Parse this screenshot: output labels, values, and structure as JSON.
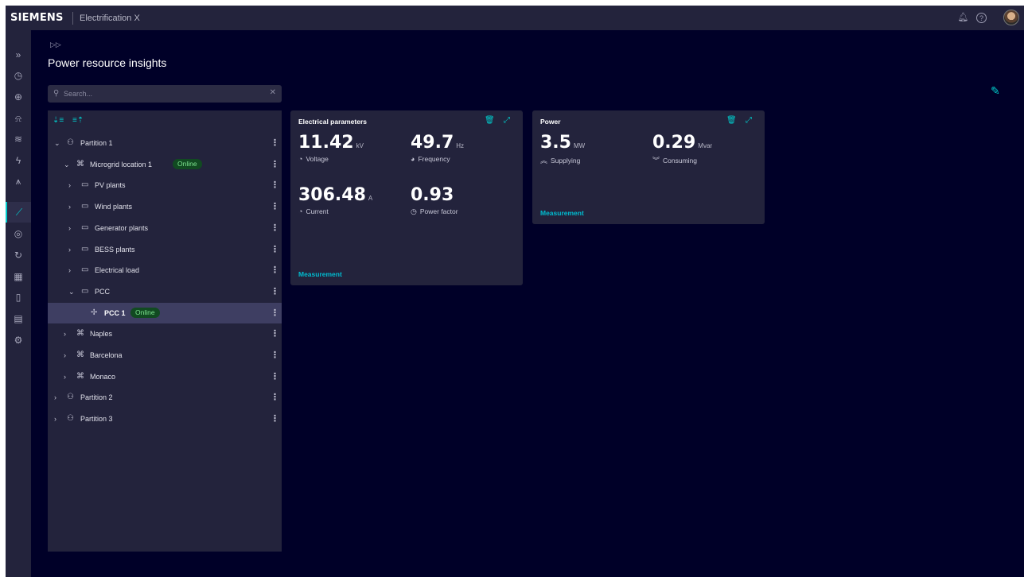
{
  "header": {
    "logo": "SIEMENS",
    "app_name": "Electrification X",
    "icons": [
      "bell-icon",
      "help-icon",
      "avatar"
    ]
  },
  "leftnav": {
    "items": [
      {
        "icon": "expand-icon",
        "glyph": "»"
      },
      {
        "icon": "clock-icon",
        "glyph": "◷"
      },
      {
        "icon": "globe-icon",
        "glyph": "⊕"
      },
      {
        "icon": "bell-icon",
        "glyph": "⍾"
      },
      {
        "icon": "layers-icon",
        "glyph": "≋"
      },
      {
        "icon": "bolt-icon",
        "glyph": "ϟ"
      },
      {
        "icon": "tower-icon",
        "glyph": "⩚"
      },
      {
        "icon": "chart-icon",
        "glyph": "⟋",
        "active": true
      },
      {
        "icon": "gauge-icon",
        "glyph": "◎"
      },
      {
        "icon": "cycle-icon",
        "glyph": "↻"
      },
      {
        "icon": "calendar-icon",
        "glyph": "▦"
      },
      {
        "icon": "document-icon",
        "glyph": "▯"
      },
      {
        "icon": "report-icon",
        "glyph": "▤"
      },
      {
        "icon": "settings-icon",
        "glyph": "⚙"
      }
    ]
  },
  "page": {
    "title": "Power resource insights"
  },
  "search": {
    "placeholder": "Search..."
  },
  "tree": {
    "rows": [
      {
        "label": "Partition 1",
        "level": 0,
        "expanded": true,
        "icon": "partition-icon",
        "glyph": "⚇"
      },
      {
        "label": "Microgrid location 1",
        "level": 1,
        "expanded": true,
        "icon": "microgrid-icon",
        "glyph": "⌘",
        "badge": "Online"
      },
      {
        "label": "PV plants",
        "level": 2,
        "expanded": false,
        "icon": "folder-icon",
        "glyph": "▭"
      },
      {
        "label": "Wind plants",
        "level": 2,
        "expanded": false,
        "icon": "folder-icon",
        "glyph": "▭"
      },
      {
        "label": "Generator plants",
        "level": 2,
        "expanded": false,
        "icon": "folder-icon",
        "glyph": "▭"
      },
      {
        "label": "BESS plants",
        "level": 2,
        "expanded": false,
        "icon": "folder-icon",
        "glyph": "▭"
      },
      {
        "label": "Electrical load",
        "level": 2,
        "expanded": false,
        "icon": "folder-icon",
        "glyph": "▭"
      },
      {
        "label": "PCC",
        "level": 2,
        "expanded": true,
        "icon": "folder-icon",
        "glyph": "▭"
      },
      {
        "label": "PCC 1",
        "level": 3,
        "leaf": true,
        "selected": true,
        "icon": "pylon-icon",
        "glyph": "✢",
        "badge": "Online"
      },
      {
        "label": "Naples",
        "level": 1,
        "expanded": false,
        "icon": "microgrid-icon",
        "glyph": "⌘"
      },
      {
        "label": "Barcelona",
        "level": 1,
        "expanded": false,
        "icon": "microgrid-icon",
        "glyph": "⌘"
      },
      {
        "label": "Monaco",
        "level": 1,
        "expanded": false,
        "icon": "microgrid-icon",
        "glyph": "⌘"
      },
      {
        "label": "Partition 2",
        "level": 0,
        "expanded": false,
        "icon": "partition-icon",
        "glyph": "⚇"
      },
      {
        "label": "Partition 3",
        "level": 0,
        "expanded": false,
        "icon": "partition-icon",
        "glyph": "⚇"
      }
    ]
  },
  "cards": {
    "electrical": {
      "title": "Electrical parameters",
      "metrics": [
        {
          "value": "11.42",
          "unit": "kV",
          "caption": "Voltage",
          "icon": "gauge-icon"
        },
        {
          "value": "49.7",
          "unit": "Hz",
          "caption": "Frequency",
          "icon": "frequency-icon"
        },
        {
          "value": "306.48",
          "unit": "A",
          "caption": "Current",
          "icon": "gauge-icon"
        },
        {
          "value": "0.93",
          "unit": "",
          "caption": "Power factor",
          "icon": "power-factor-icon"
        }
      ],
      "link": "Measurement"
    },
    "power": {
      "title": "Power",
      "metrics": [
        {
          "value": "3.5",
          "unit": "MW",
          "caption": "Supplying",
          "icon": "double-chevron-up-icon"
        },
        {
          "value": "0.29",
          "unit": "Mvar",
          "caption": "Consuming",
          "icon": "double-chevron-down-icon"
        }
      ],
      "link": "Measurement"
    }
  },
  "colors": {
    "background": "#000028",
    "panel": "#23233c",
    "accent": "#00cccc",
    "online_bg": "#114a21",
    "online_text": "#7de38f"
  }
}
